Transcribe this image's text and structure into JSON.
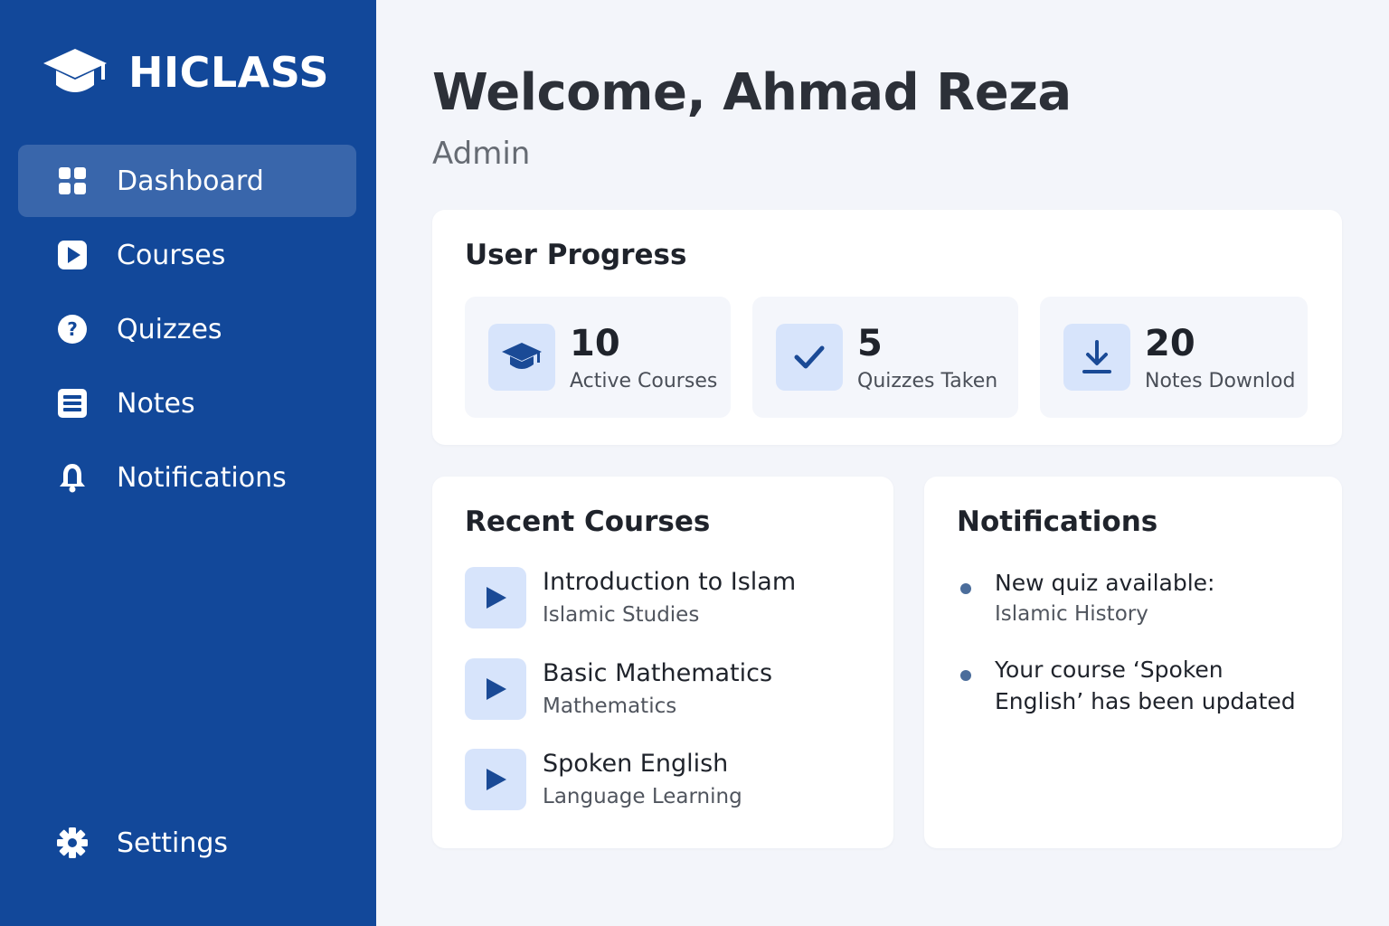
{
  "brand": {
    "name": "HICLASS",
    "icon": "graduation-cap-icon"
  },
  "sidebar": {
    "items": [
      {
        "label": "Dashboard",
        "icon": "grid-icon",
        "active": true
      },
      {
        "label": "Courses",
        "icon": "play-icon",
        "active": false
      },
      {
        "label": "Quizzes",
        "icon": "question-icon",
        "active": false
      },
      {
        "label": "Notes",
        "icon": "notes-icon",
        "active": false
      },
      {
        "label": "Notifications",
        "icon": "bell-icon",
        "active": false
      }
    ],
    "settings": {
      "label": "Settings",
      "icon": "gear-icon"
    }
  },
  "header": {
    "welcome": "Welcome, Ahmad Reza",
    "role": "Admin"
  },
  "progress": {
    "title": "User Progress",
    "stats": [
      {
        "value": "10",
        "label": "Active Courses",
        "icon": "graduation-cap-icon"
      },
      {
        "value": "5",
        "label": "Quizzes Taken",
        "icon": "check-icon"
      },
      {
        "value": "20",
        "label": "Notes Downlod",
        "icon": "download-icon"
      }
    ]
  },
  "recent_courses": {
    "title": "Recent Courses",
    "items": [
      {
        "title": "Introduction to Islam",
        "category": "Islamic Studies"
      },
      {
        "title": "Basic Mathematics",
        "category": "Mathematics"
      },
      {
        "title": "Spoken English",
        "category": "Language Learning"
      }
    ]
  },
  "notifications": {
    "title": "Notifications",
    "items": [
      {
        "line1": "New quiz available:",
        "line2": "Islamic History"
      },
      {
        "line1": "Your course ‘Spoken",
        "line2": "English’ has been updated"
      }
    ]
  },
  "colors": {
    "sidebar": "#12489a",
    "background": "#f3f5fa",
    "icon_tile": "#d7e4fb",
    "accent": "#1a4a96"
  }
}
